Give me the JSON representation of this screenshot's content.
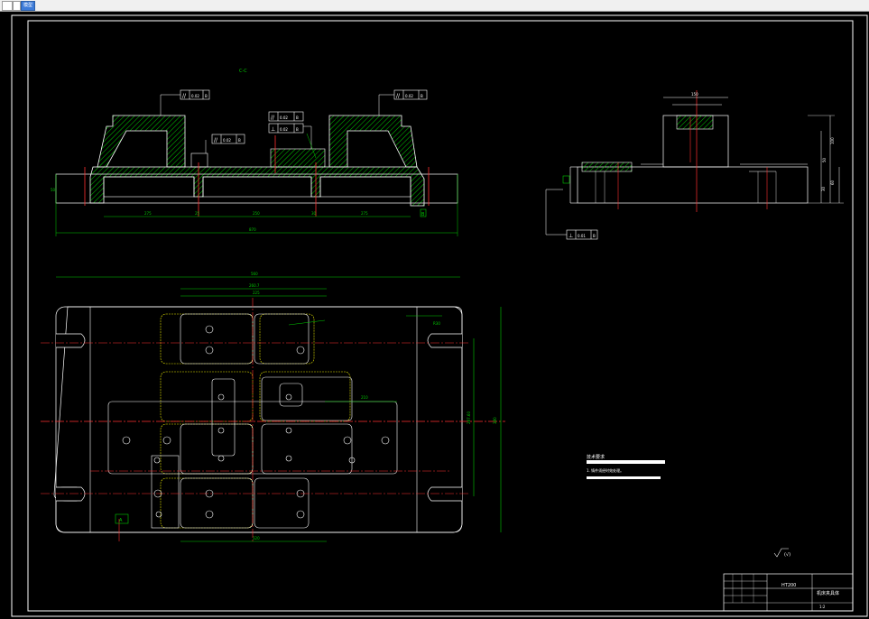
{
  "app": {
    "tabs": [
      {
        "label": "",
        "active": false
      },
      {
        "label": "",
        "active": false
      },
      {
        "label": "模型",
        "active": true
      }
    ]
  },
  "drawing": {
    "section_label": "C-C",
    "gdt": {
      "parallel_1": "0.02",
      "parallel_1_datum": "B",
      "parallel_2": "0.02",
      "parallel_2_datum": "B",
      "parallel_3": "0.02",
      "parallel_3_datum": "B",
      "parallel_4": "0.02",
      "parallel_4_datum": "B",
      "perp_1": "0.02",
      "perp_1_datum": "B",
      "side_view": "0.01",
      "side_view_datum": "B",
      "datum_a": "A",
      "datum_b": "B"
    },
    "dims": {
      "front_total": "870",
      "front_left": "275",
      "front_mid": "250",
      "front_right": "275",
      "front_small_a": "25",
      "front_small_b": "30",
      "front_height": "50",
      "plan_total": "560",
      "plan_upper_1": "260.7",
      "plan_upper_2": "225",
      "plan_bottom": "320",
      "plan_height_total": "380",
      "plan_height_inner": "287.60",
      "plan_slot": "210",
      "plan_r": "R30",
      "side_top": "150",
      "side_h1": "100",
      "side_h2": "50",
      "side_h3": "60",
      "side_h4": "30"
    },
    "notes": {
      "title": "技术要求",
      "line1": "1. 铸件须经时效处理。"
    },
    "roughness": "(√)",
    "title_block": {
      "material": "HT200",
      "name": "机床夹具体",
      "scale": "1:2"
    }
  }
}
